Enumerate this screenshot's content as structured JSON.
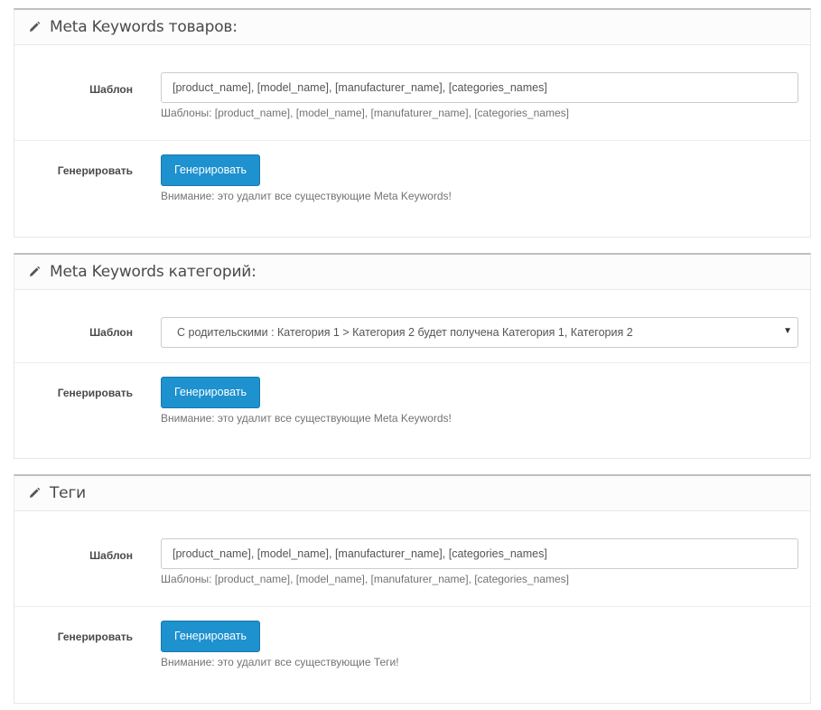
{
  "sections": [
    {
      "title": "Meta Keywords товаров:",
      "template_label": "Шаблон",
      "template_value": "[product_name], [model_name], [manufacturer_name], [categories_names]",
      "template_help": "Шаблоны: [product_name], [model_name], [manufaturer_name], [categories_names]",
      "generate_label": "Генерировать",
      "generate_button": "Генерировать",
      "generate_warning": "Внимание: это удалит все существующие Meta Keywords!"
    },
    {
      "title": "Meta Keywords категорий:",
      "template_label": "Шаблон",
      "template_select_value": "С родительскими : Категория 1 > Категория 2 будет получена Категория 1, Категория 2",
      "generate_label": "Генерировать",
      "generate_button": "Генерировать",
      "generate_warning": "Внимание: это удалит все существующие Meta Keywords!"
    },
    {
      "title": "Теги",
      "template_label": "Шаблон",
      "template_value": "[product_name], [model_name], [manufacturer_name], [categories_names]",
      "template_help": "Шаблоны: [product_name], [model_name], [manufaturer_name], [categories_names]",
      "generate_label": "Генерировать",
      "generate_button": "Генерировать",
      "generate_warning": "Внимание: это удалит все существующие Теги!"
    }
  ],
  "icons": {
    "heading": "pencil-icon",
    "select_caret": "caret-down-icon"
  },
  "colors": {
    "button": "#1e91cf",
    "panel_top_border": "#bfbfbf"
  }
}
